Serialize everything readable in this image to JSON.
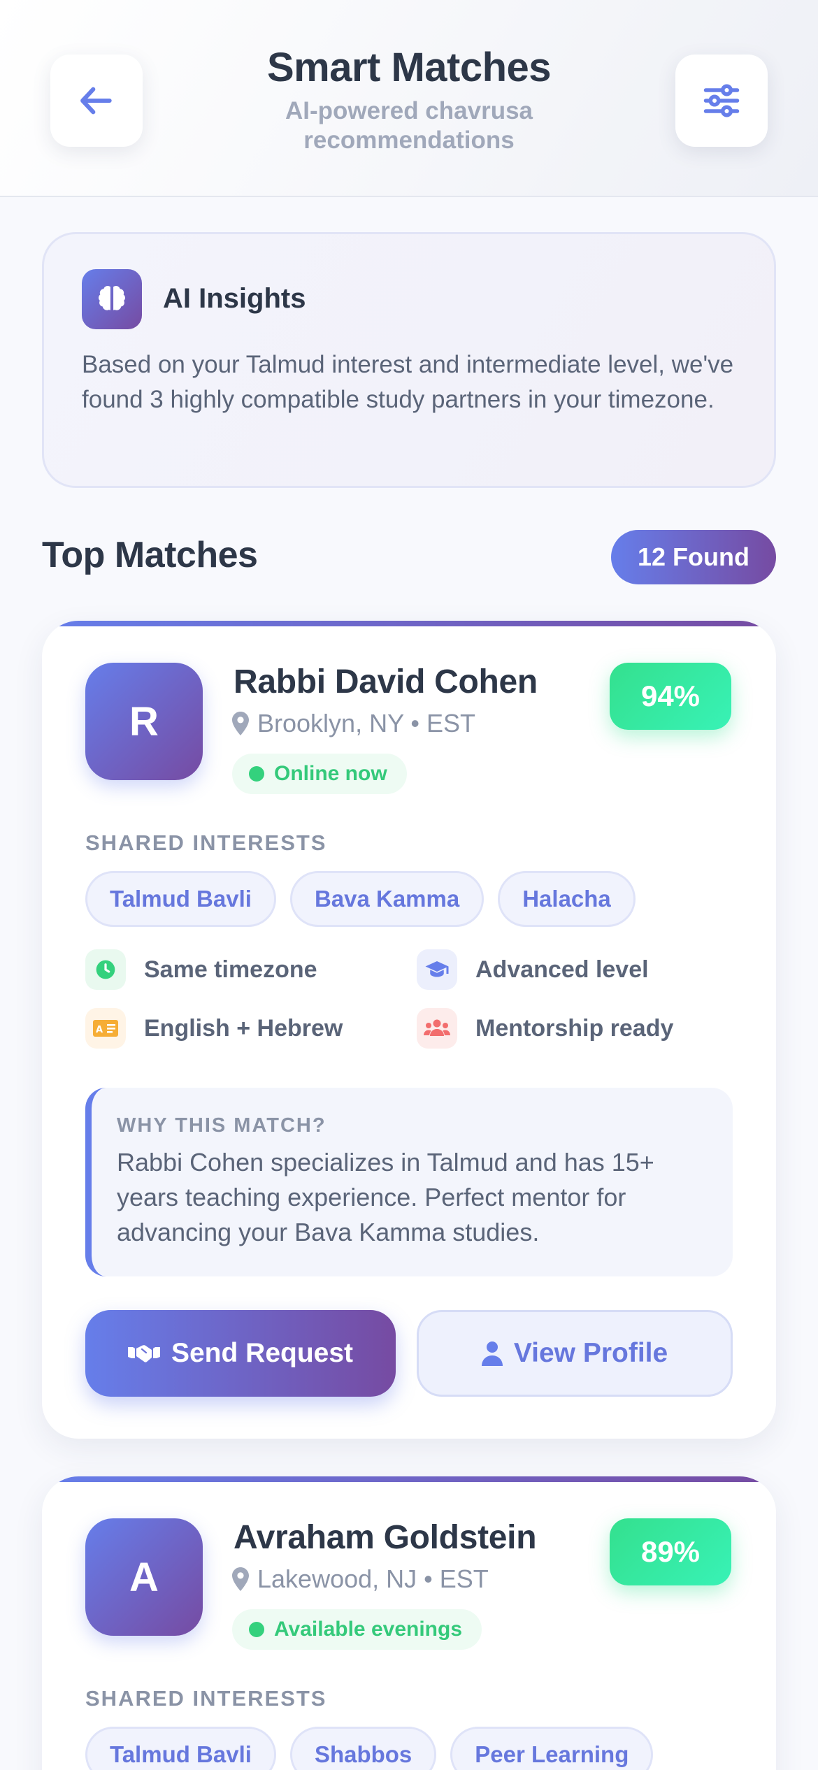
{
  "header": {
    "title": "Smart Matches",
    "subtitle_line1": "AI-powered chavrusa",
    "subtitle_line2": "recommendations",
    "back_icon": "arrow-left-icon",
    "filter_icon": "sliders-icon"
  },
  "insights": {
    "icon": "brain-icon",
    "title": "AI Insights",
    "text": "Based on your Talmud interest and intermediate level, we've found 3 highly compatible study partners in your timezone."
  },
  "section": {
    "title": "Top Matches",
    "badge": "12 Found"
  },
  "colors": {
    "accent_start": "#667eea",
    "accent_end": "#764ba2",
    "success": "#34d17d",
    "text_dark": "#2d3748",
    "text_muted": "#8a93a6"
  },
  "matches": [
    {
      "initial": "R",
      "name": "Rabbi David Cohen",
      "location": "Brooklyn, NY • EST",
      "status": "Online now",
      "score": "94%",
      "shared_label": "SHARED INTERESTS",
      "tags": [
        "Talmud Bavli",
        "Bava Kamma",
        "Halacha"
      ],
      "features": [
        {
          "icon": "clock-icon",
          "label": "Same timezone"
        },
        {
          "icon": "graduation-cap-icon",
          "label": "Advanced level"
        },
        {
          "icon": "language-icon",
          "label": "English + Hebrew"
        },
        {
          "icon": "users-icon",
          "label": "Mentorship ready"
        }
      ],
      "why_label": "WHY THIS MATCH?",
      "why_text": "Rabbi Cohen specializes in Talmud and has 15+ years teaching experience. Perfect mentor for advancing your Bava Kamma studies.",
      "send_label": "Send Request",
      "view_label": "View Profile"
    },
    {
      "initial": "A",
      "name": "Avraham Goldstein",
      "location": "Lakewood, NJ • EST",
      "status": "Available evenings",
      "score": "89%",
      "shared_label": "SHARED INTERESTS",
      "tags": [
        "Talmud Bavli",
        "Shabbos",
        "Peer Learning"
      ]
    }
  ]
}
